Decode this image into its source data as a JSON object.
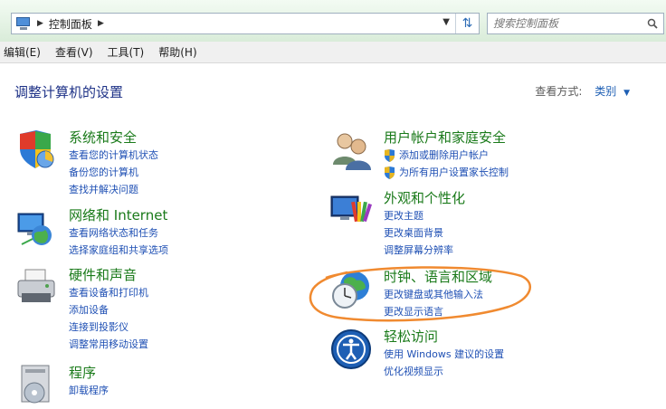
{
  "address": {
    "breadcrumb": "控制面板",
    "search_placeholder": "搜索控制面板"
  },
  "menu": [
    "编辑(E)",
    "查看(V)",
    "工具(T)",
    "帮助(H)"
  ],
  "page_title": "调整计算机的设置",
  "view_by": {
    "label": "查看方式:",
    "value": "类别"
  },
  "left_categories": [
    {
      "title": "系统和安全",
      "links": [
        "查看您的计算机状态",
        "备份您的计算机",
        "查找并解决问题"
      ]
    },
    {
      "title": "网络和 Internet",
      "links": [
        "查看网络状态和任务",
        "选择家庭组和共享选项"
      ]
    },
    {
      "title": "硬件和声音",
      "links": [
        "查看设备和打印机",
        "添加设备",
        "连接到投影仪",
        "调整常用移动设置"
      ]
    },
    {
      "title": "程序",
      "links": [
        "卸载程序"
      ]
    }
  ],
  "right_categories": [
    {
      "title": "用户帐户和家庭安全",
      "links": [
        "添加或删除用户帐户",
        "为所有用户设置家长控制"
      ]
    },
    {
      "title": "外观和个性化",
      "links": [
        "更改主题",
        "更改桌面背景",
        "调整屏幕分辨率"
      ]
    },
    {
      "title": "时钟、语言和区域",
      "links": [
        "更改键盘或其他输入法",
        "更改显示语言"
      ]
    },
    {
      "title": "轻松访问",
      "links": [
        "使用 Windows 建议的设置",
        "优化视频显示"
      ]
    }
  ],
  "colors": {
    "category_title": "#1a7a1a",
    "link": "#1f50b4",
    "heading": "#1e3287",
    "annotation": "#f08a30"
  }
}
